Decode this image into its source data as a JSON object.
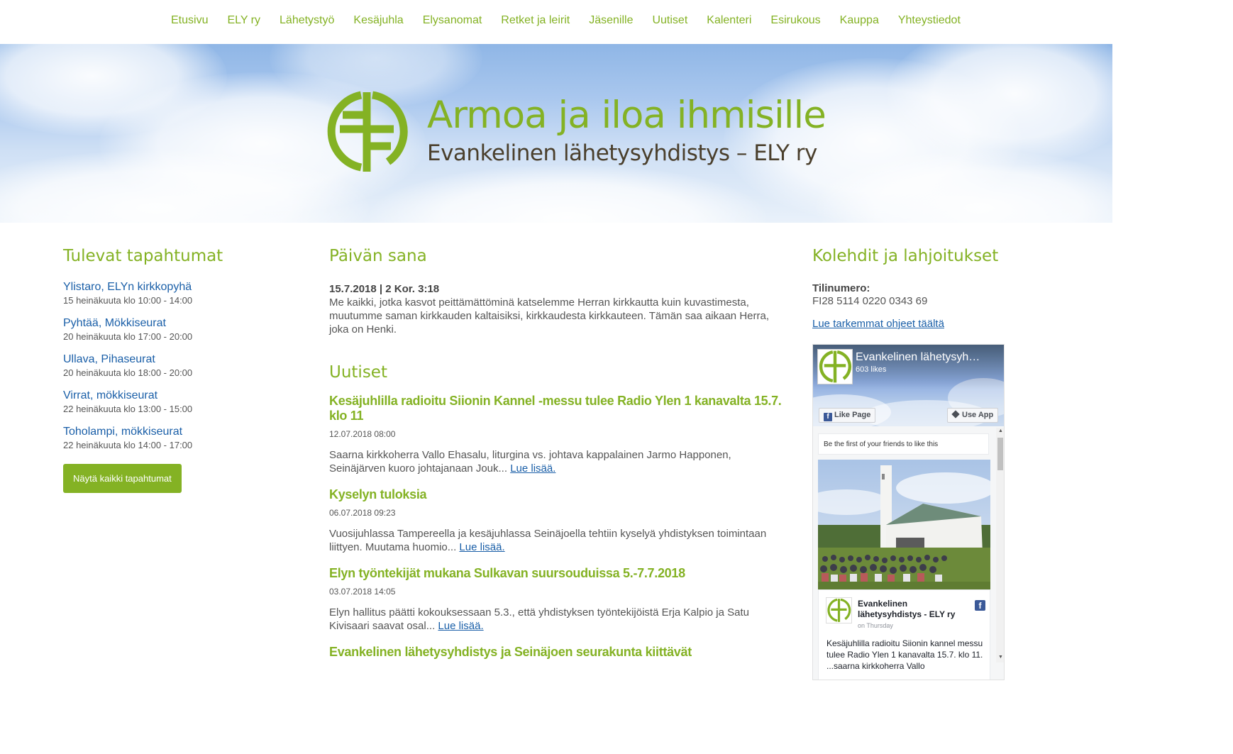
{
  "nav": {
    "items": [
      "Etusivu",
      "ELY ry",
      "Lähetystyö",
      "Kesäjuhla",
      "Elysanomat",
      "Retket ja leirit",
      "Jäsenille",
      "Uutiset",
      "Kalenteri",
      "Esirukous",
      "Kauppa",
      "Yhteystiedot"
    ]
  },
  "hero": {
    "title": "Armoa ja iloa ihmisille",
    "subtitle": "Evankelinen lähetysyhdistys – ELY ry",
    "logo_icon": "ely-cross-logo-icon",
    "brand_color": "#84b224"
  },
  "events": {
    "heading": "Tulevat tapahtumat",
    "items": [
      {
        "title": "Ylistaro, ELYn kirkkopyhä",
        "time": "15 heinäkuuta klo 10:00 - 14:00"
      },
      {
        "title": "Pyhtää, Mökkiseurat",
        "time": "20 heinäkuuta klo 17:00 - 20:00"
      },
      {
        "title": "Ullava, Pihaseurat",
        "time": "20 heinäkuuta klo 18:00 - 20:00"
      },
      {
        "title": "Virrat, mökkiseurat",
        "time": "22 heinäkuuta klo 13:00 - 15:00"
      },
      {
        "title": "Toholampi, mökkiseurat",
        "time": "22 heinäkuuta klo 14:00 - 17:00"
      }
    ],
    "show_all_label": "Näytä kaikki tapahtumat"
  },
  "verse": {
    "heading": "Päivän sana",
    "reference": "15.7.2018 | 2 Kor. 3:18",
    "text": "Me kaikki, jotka kasvot peittämättöminä katselemme Herran kirkkautta kuin kuvastimesta, muutumme saman kirkkauden kaltaisiksi, kirkkaudesta kirkkauteen. Tämän saa aikaan Herra, joka on Henki."
  },
  "news": {
    "heading": "Uutiset",
    "read_more": "Lue lisää.",
    "items": [
      {
        "title": "Kesäjuhlilla radioitu Siionin Kannel -messu tulee Radio Ylen 1 kanavalta 15.7. klo 11",
        "date": "12.07.2018 08:00",
        "excerpt": "Saarna kirkkoherra Vallo Ehasalu, liturgina vs. johtava kappalainen Jarmo Happonen, Seinäjärven kuoro johtajanaan Jouk..."
      },
      {
        "title": "Kyselyn tuloksia",
        "date": "06.07.2018 09:23",
        "excerpt": "Vuosijuhlassa Tampereella ja kesäjuhlassa Seinäjoella tehtiin kyselyä yhdistyksen toimintaan liittyen. Muutama huomio..."
      },
      {
        "title": "Elyn työntekijät mukana Sulkavan suursouduissa 5.-7.7.2018",
        "date": "03.07.2018 14:05",
        "excerpt": "Elyn hallitus päätti kokouksessaan 5.3., että yhdistyksen työntekijöistä Erja Kalpio ja Satu Kivisaari saavat osal..."
      },
      {
        "title": "Evankelinen lähetysyhdistys ja Seinäjoen seurakunta kiittävät"
      }
    ]
  },
  "donations": {
    "heading": "Kolehdit ja lahjoitukset",
    "account_label": "Tilinumero:",
    "account_number": "FI28 5114 0220 0343 69",
    "instructions_link": "Lue tarkemmat ohjeet täältä"
  },
  "facebook": {
    "page_name": "Evankelinen lähetysyh…",
    "likes": "603 likes",
    "like_button": "Like Page",
    "app_button": "Use App",
    "friends_text": "Be the first of your friends to like this",
    "post": {
      "author": "Evankelinen lähetysyhdistys - ELY ry",
      "when": "on Thursday",
      "text": "Kesäjuhlilla radioitu Siionin kannel messu tulee Radio Ylen 1 kanavalta 15.7. klo 11. ...saarna kirkkoherra Vallo"
    }
  }
}
